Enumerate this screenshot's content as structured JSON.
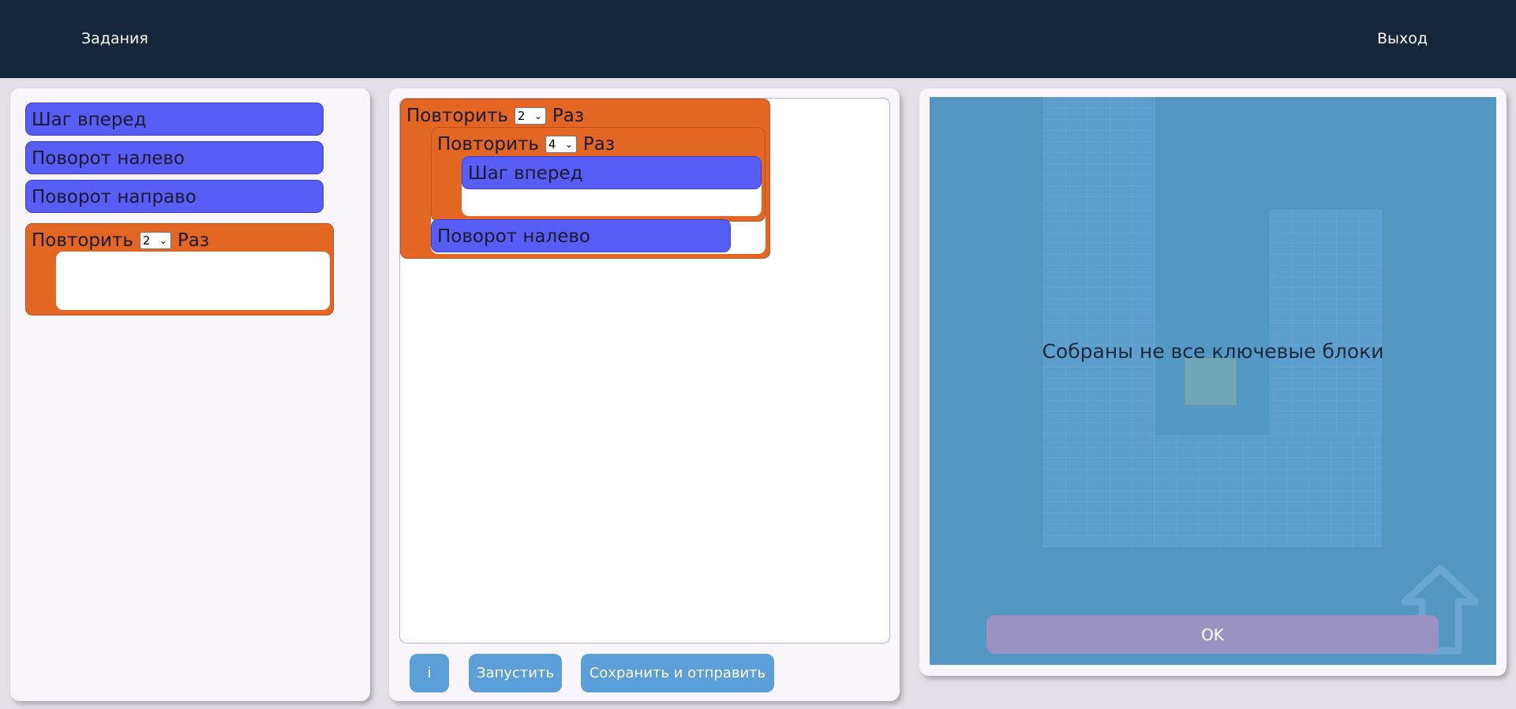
{
  "topbar": {
    "tasks_label": "Задания",
    "exit_label": "Выход"
  },
  "palette": {
    "commands": [
      "Шаг вперед",
      "Поворот налево",
      "Поворот направо"
    ],
    "repeat": {
      "label": "Повторить",
      "count": "2",
      "suffix": "Раз"
    }
  },
  "workspace": {
    "outer_repeat": {
      "label": "Повторить",
      "count": "2",
      "suffix": "Раз"
    },
    "inner_repeat": {
      "label": "Повторить",
      "count": "4",
      "suffix": "Раз"
    },
    "inner_command": "Шаг вперед",
    "after_command": "Поворот налево"
  },
  "buttons": {
    "info": "i",
    "run": "Запустить",
    "save": "Сохранить и отправить"
  },
  "stage": {
    "message": "Собраны не все ключевые блоки",
    "ok_label": "OK"
  },
  "colors": {
    "command_block": "#575ef5",
    "repeat_block": "#e36622",
    "topbar": "#13263b",
    "button": "#5a9fd8",
    "stage_background": "#5496c2"
  }
}
